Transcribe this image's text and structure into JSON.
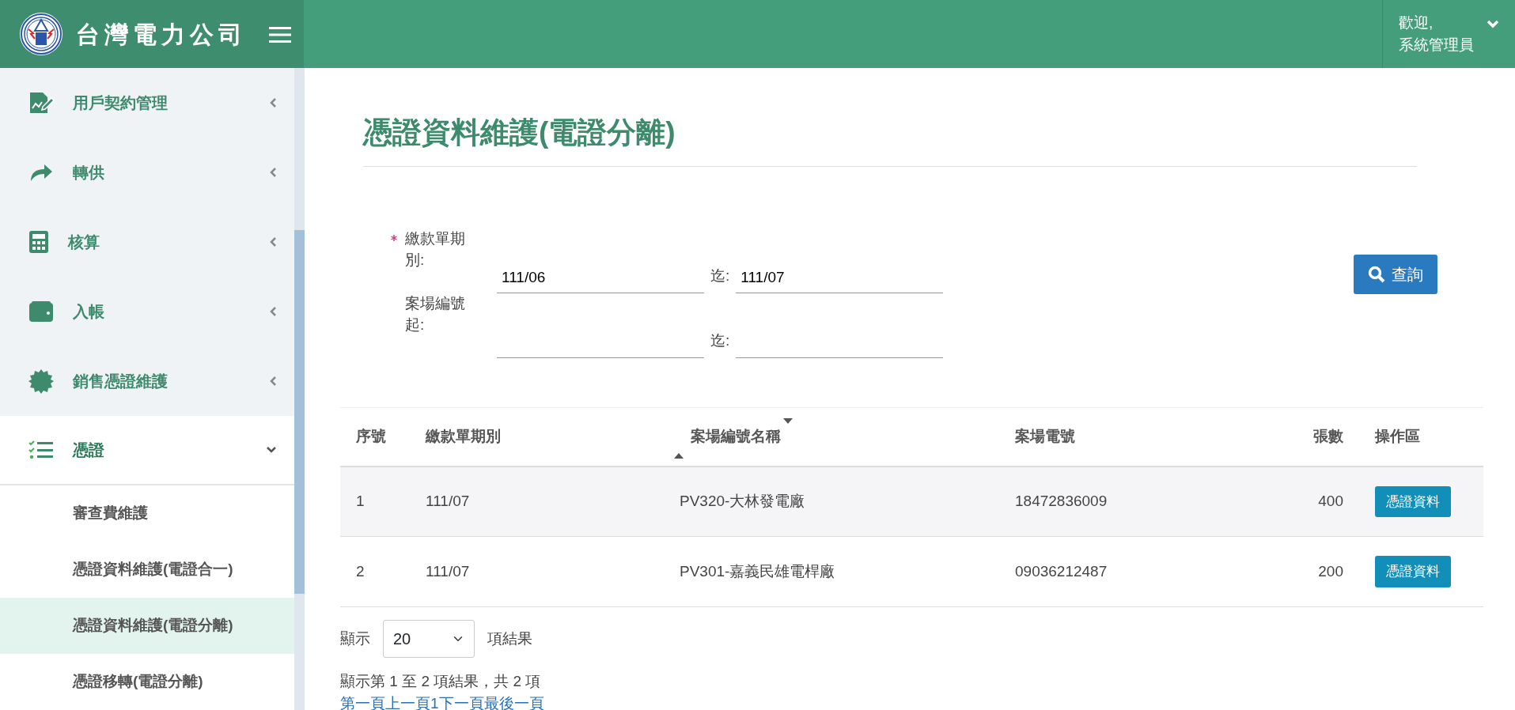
{
  "header": {
    "brand": "台灣電力公司",
    "greeting": "歡迎,",
    "user_name": "系統管理員"
  },
  "sidebar": {
    "items": [
      {
        "label": "用戶契約管理",
        "expanded": false
      },
      {
        "label": "轉供",
        "expanded": false
      },
      {
        "label": "核算",
        "expanded": false
      },
      {
        "label": "入帳",
        "expanded": false
      },
      {
        "label": "銷售憑證維護",
        "expanded": false
      },
      {
        "label": "憑證",
        "expanded": true,
        "children": [
          {
            "label": "審查費維護",
            "selected": false
          },
          {
            "label": "憑證資料維護(電證合一)",
            "selected": false
          },
          {
            "label": "憑證資料維護(電證分離)",
            "selected": true
          },
          {
            "label": "憑證移轉(電證分離)",
            "selected": false
          }
        ]
      }
    ]
  },
  "page": {
    "title": "憑證資料維護(電證分離)"
  },
  "form": {
    "rows": [
      {
        "label": "繳款單期別:",
        "required": true,
        "from_value": "111/06",
        "to_label": "迄:",
        "to_value": "111/07"
      },
      {
        "label": "案場編號起:",
        "required": false,
        "from_value": "",
        "to_label": "迄:",
        "to_value": ""
      }
    ],
    "search_button": "查詢"
  },
  "table": {
    "columns": [
      {
        "label": "序號",
        "sortable": false
      },
      {
        "label": "繳款單期別",
        "sortable": false
      },
      {
        "label": "案場編號名稱",
        "sortable": true
      },
      {
        "label": "案場電號",
        "sortable": false
      },
      {
        "label": "張數",
        "sortable": false
      },
      {
        "label": "操作區",
        "sortable": false
      }
    ],
    "rows": [
      {
        "cells": [
          "1",
          "111/07",
          "PV320-大林發電廠",
          "18472836009",
          "400"
        ],
        "action": "憑證資料"
      },
      {
        "cells": [
          "2",
          "111/07",
          "PV301-嘉義民雄電桿廠",
          "09036212487",
          "200"
        ],
        "action": "憑證資料"
      }
    ]
  },
  "length": {
    "before": "顯示",
    "value": "20",
    "after": "項結果"
  },
  "info": "顯示第 1 至 2 項結果，共 2 項",
  "pagination": [
    "第一頁",
    "上一頁",
    "1",
    "下一頁",
    "最後一頁"
  ]
}
